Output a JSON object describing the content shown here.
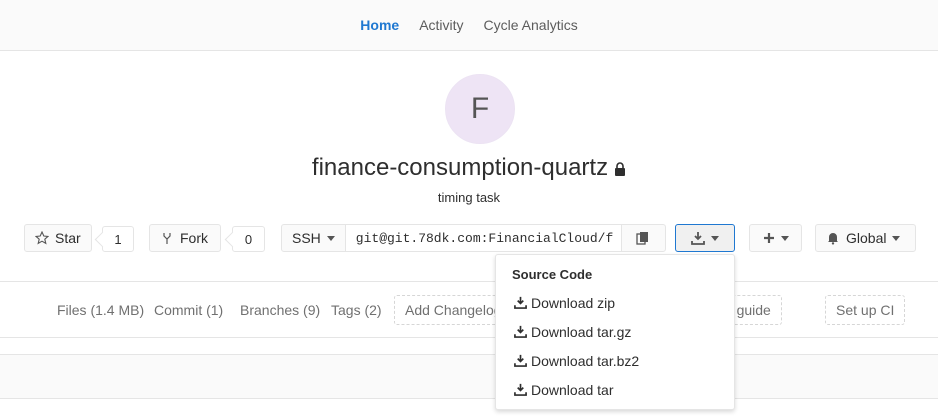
{
  "nav": {
    "tabs": [
      {
        "label": "Home",
        "active": true
      },
      {
        "label": "Activity",
        "active": false
      },
      {
        "label": "Cycle Analytics",
        "active": false
      }
    ]
  },
  "project": {
    "avatar_letter": "F",
    "name": "finance-consumption-quartz",
    "description": "timing task",
    "visibility_icon": "lock-icon"
  },
  "actions": {
    "star_label": "Star",
    "star_count": "1",
    "fork_label": "Fork",
    "fork_count": "0",
    "protocol": "SSH",
    "clone_url": "git@git.78dk.com:FinancialCloud/f",
    "notification_label": "Global"
  },
  "stats": {
    "files": "Files (1.4 MB)",
    "commits": "Commit (1)",
    "branches": "Branches (9)",
    "tags": "Tags (2)",
    "add_changelog": "Add Changelog",
    "contribution_guide": "ition guide",
    "setup_ci": "Set up CI"
  },
  "download_menu": {
    "header": "Source Code",
    "items": [
      "Download zip",
      "Download tar.gz",
      "Download tar.bz2",
      "Download tar"
    ]
  },
  "colors": {
    "accent": "#1f78d1",
    "avatar_bg": "#eee4f5",
    "active_button_border": "#1f78d1"
  }
}
